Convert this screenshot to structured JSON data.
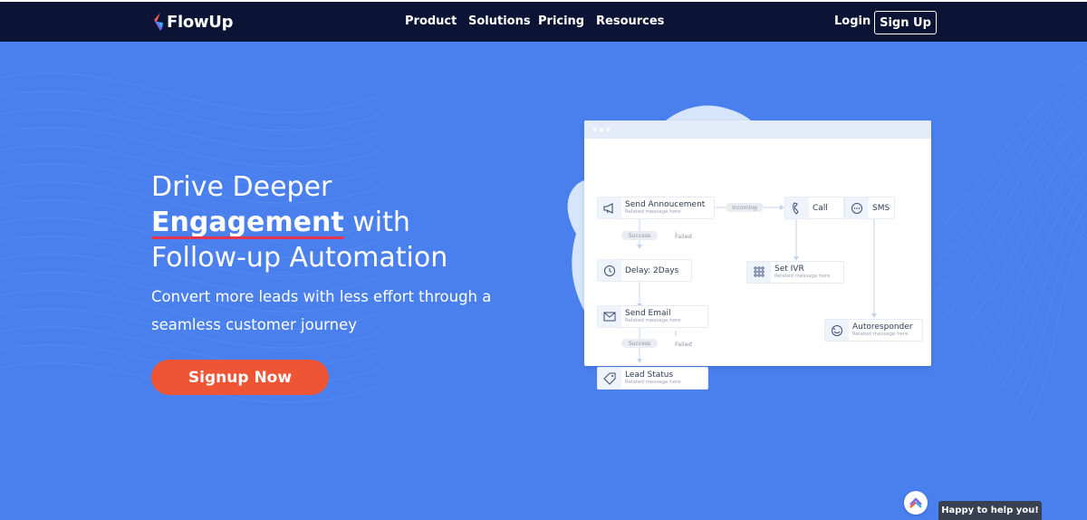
{
  "brand": {
    "name": "FlowUp",
    "logo_colors": [
      "#ff5a3d",
      "#7b68ee",
      "#3ab0ff"
    ]
  },
  "nav": {
    "links": [
      "Product",
      "Solutions",
      "Pricing",
      "Resources"
    ],
    "login": "Login",
    "signup": "Sign Up"
  },
  "hero": {
    "title_line1": "Drive Deeper",
    "title_emph": "Engagement",
    "title_line2_rest": " with",
    "title_line3": "Follow-up Automation",
    "subtitle": "Convert more leads with less effort through a seamless customer journey",
    "cta": "Signup Now"
  },
  "flow": {
    "nodes": [
      {
        "title": "Send Annoucement",
        "sub": "Related message here",
        "icon": "megaphone-icon"
      },
      {
        "title": "Call",
        "sub": "",
        "icon": "phone-icon"
      },
      {
        "title": "SMS",
        "sub": "",
        "icon": "chat-bubble-icon"
      },
      {
        "title": "Delay: 2Days",
        "sub": "",
        "icon": "clock-icon"
      },
      {
        "title": "Set IVR",
        "sub": "Related message here",
        "icon": "keypad-icon"
      },
      {
        "title": "Send Email",
        "sub": "Related message here",
        "icon": "envelope-icon"
      },
      {
        "title": "Autoresponder",
        "sub": "Related message here",
        "icon": "autoresponder-icon"
      },
      {
        "title": "Lead Status",
        "sub": "Related message here",
        "icon": "tag-icon"
      }
    ],
    "labels": {
      "incoming": "Incoming",
      "success": "Success",
      "failed": "Failed"
    }
  },
  "chat": {
    "label": "Happy to help you!"
  },
  "colors": {
    "navbar": "#0b1435",
    "hero_bg": "#4a80ee",
    "cta": "#ee5535",
    "underline": "#e8344e"
  }
}
